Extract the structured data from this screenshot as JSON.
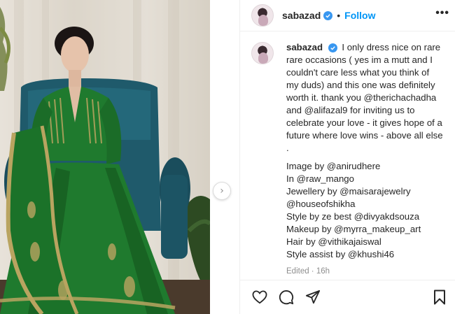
{
  "post": {
    "username": "sabazad",
    "follow_label": "Follow",
    "separator": "•",
    "more_label": "•••",
    "caption": [
      "I only dress nice on rare",
      "rare occasions ( yes im a mutt and I",
      "couldn't care less what you think of",
      "my duds) and this one was definitely",
      "worth it. thank you @therichachadha",
      "and @alifazal9 for inviting us to",
      "celebrate your love - it gives hope of a",
      "future where love wins - above all else",
      "."
    ],
    "credits": [
      "Image by @anirudhere",
      "In @raw_mango",
      "Jewellery by @maisarajewelry",
      "@houseofshikha",
      "Style by ze best @divyakdsouza",
      "Makeup by @myrra_makeup_art",
      "Hair by @vithikajaiswal",
      "Style assist by @khushi46"
    ],
    "edited": "Edited · 16h"
  },
  "icons": {
    "verified": "verified-badge-icon",
    "like": "heart-icon",
    "comment": "speech-bubble-icon",
    "share": "paper-plane-icon",
    "save": "bookmark-icon",
    "next": "chevron-right-icon"
  },
  "colors": {
    "link": "#0095f6",
    "verified": "#3897f0",
    "text": "#262626",
    "muted": "#8e8e8e",
    "dress_green": "#1f7a2e",
    "chair_teal": "#1f5a6b"
  }
}
